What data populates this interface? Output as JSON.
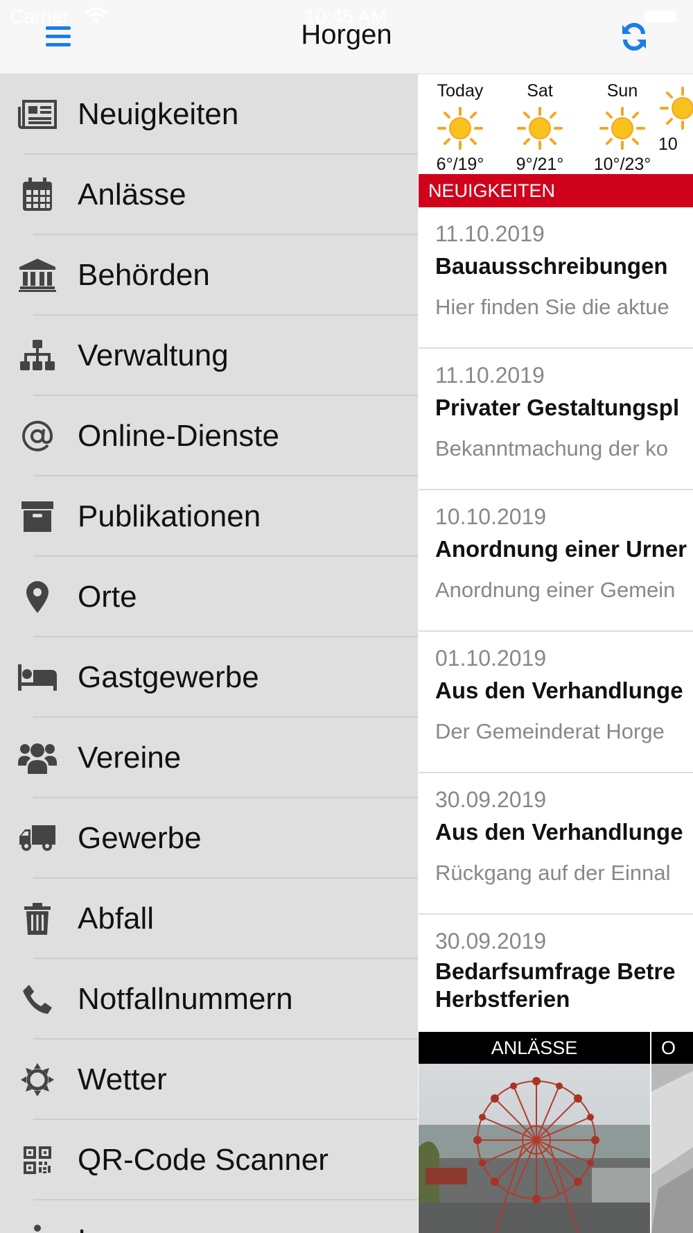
{
  "status": {
    "carrier": "Carrier",
    "time": "10:45 AM"
  },
  "header": {
    "title": "Horgen"
  },
  "menu": [
    {
      "label": "Neuigkeiten",
      "icon": "newspaper-icon"
    },
    {
      "label": "Anlässe",
      "icon": "calendar-icon"
    },
    {
      "label": "Behörden",
      "icon": "institution-icon"
    },
    {
      "label": "Verwaltung",
      "icon": "sitemap-icon"
    },
    {
      "label": "Online-Dienste",
      "icon": "at-icon"
    },
    {
      "label": "Publikationen",
      "icon": "archive-icon"
    },
    {
      "label": "Orte",
      "icon": "map-marker-icon"
    },
    {
      "label": "Gastgewerbe",
      "icon": "bed-icon"
    },
    {
      "label": "Vereine",
      "icon": "users-icon"
    },
    {
      "label": "Gewerbe",
      "icon": "truck-icon"
    },
    {
      "label": "Abfall",
      "icon": "trash-icon"
    },
    {
      "label": "Notfallnummern",
      "icon": "phone-icon"
    },
    {
      "label": "Wetter",
      "icon": "sun-outline-icon"
    },
    {
      "label": "QR-Code Scanner",
      "icon": "qrcode-icon"
    },
    {
      "label": "Impressum",
      "icon": "info-icon"
    }
  ],
  "weather": [
    {
      "day": "Today",
      "temp": "6°/19°"
    },
    {
      "day": "Sat",
      "temp": "9°/21°"
    },
    {
      "day": "Sun",
      "temp": "10°/23°"
    },
    {
      "day": "",
      "temp": "10"
    }
  ],
  "news_section": "NEUIGKEITEN",
  "news": [
    {
      "date": "11.10.2019",
      "title": "Bauausschreibungen",
      "snippet": "Hier finden Sie die aktue"
    },
    {
      "date": "11.10.2019",
      "title": "Privater Gestaltungspl",
      "snippet": "Bekanntmachung der ko"
    },
    {
      "date": "10.10.2019",
      "title": "Anordnung einer Urner",
      "snippet": "Anordnung einer Gemein"
    },
    {
      "date": "01.10.2019",
      "title": "Aus den Verhandlunge",
      "snippet": "Der Gemeinderat Horge"
    },
    {
      "date": "30.09.2019",
      "title": "Aus den Verhandlunge",
      "snippet": "Rückgang auf der Einnal"
    },
    {
      "date": "30.09.2019",
      "title": "Bedarfsumfrage Betre Herbstferien",
      "snippet": ""
    }
  ],
  "cards": [
    {
      "label": "ANLÄSSE"
    },
    {
      "label": "O"
    }
  ],
  "colors": {
    "accent": "#1a7ee6",
    "section": "#d0021b",
    "sun": "#f5a623",
    "sidebar": "#dfdfdf"
  }
}
